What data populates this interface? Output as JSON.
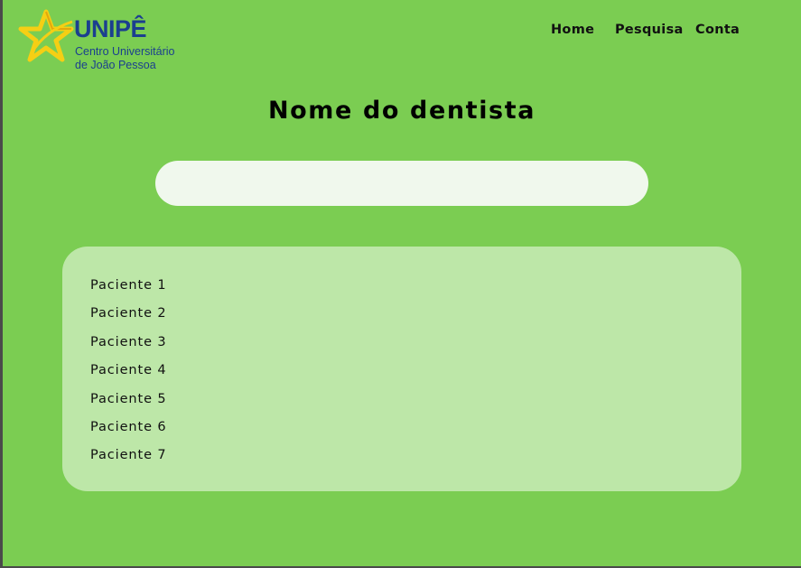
{
  "colors": {
    "background": "#7bcd52",
    "search_field": "#f0f8ed",
    "list_panel": "#bde7a8",
    "logo_blue": "#1b3f8f",
    "logo_star": "#f5cf14"
  },
  "logo": {
    "icon": "star-icon",
    "name": "UNIPÊ",
    "subtitle_line1": "Centro Universitário",
    "subtitle_line2": "de João Pessoa"
  },
  "nav": {
    "items": [
      {
        "label": "Home"
      },
      {
        "label": "Pesquisa"
      },
      {
        "label": "Conta"
      }
    ]
  },
  "page": {
    "title": "Nome do dentista"
  },
  "search": {
    "value": "",
    "placeholder": ""
  },
  "patients": [
    {
      "label": "Paciente 1"
    },
    {
      "label": "Paciente 2"
    },
    {
      "label": "Paciente 3"
    },
    {
      "label": "Paciente 4"
    },
    {
      "label": "Paciente 5"
    },
    {
      "label": "Paciente 6"
    },
    {
      "label": "Paciente 7"
    }
  ]
}
